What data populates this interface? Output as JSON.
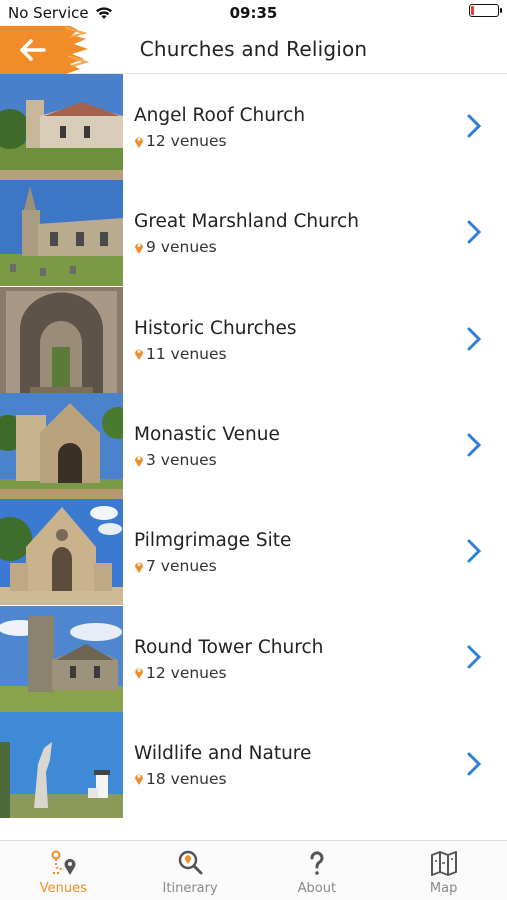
{
  "status_bar": {
    "carrier": "No Service",
    "time": "09:35"
  },
  "header": {
    "title": "Churches and Religion"
  },
  "items": [
    {
      "title": "Angel Roof Church",
      "count": "12 venues"
    },
    {
      "title": "Great Marshland Church",
      "count": "9 venues"
    },
    {
      "title": "Historic Churches",
      "count": "11 venues"
    },
    {
      "title": "Monastic Venue",
      "count": "3 venues"
    },
    {
      "title": "Pilmgrimage Site",
      "count": "7 venues"
    },
    {
      "title": "Round Tower Church",
      "count": "12 venues"
    },
    {
      "title": "Wildlife and Nature",
      "count": "18 venues"
    }
  ],
  "tabs": [
    {
      "label": "Venues",
      "icon": "venues-route-icon",
      "active": true
    },
    {
      "label": "Itinerary",
      "icon": "itinerary-search-icon",
      "active": false
    },
    {
      "label": "About",
      "icon": "question-mark-icon",
      "active": false
    },
    {
      "label": "Map",
      "icon": "map-icon",
      "active": false
    }
  ],
  "colors": {
    "accent": "#f28c28",
    "chevron": "#2f7fd8",
    "pin": "#f28c28"
  }
}
